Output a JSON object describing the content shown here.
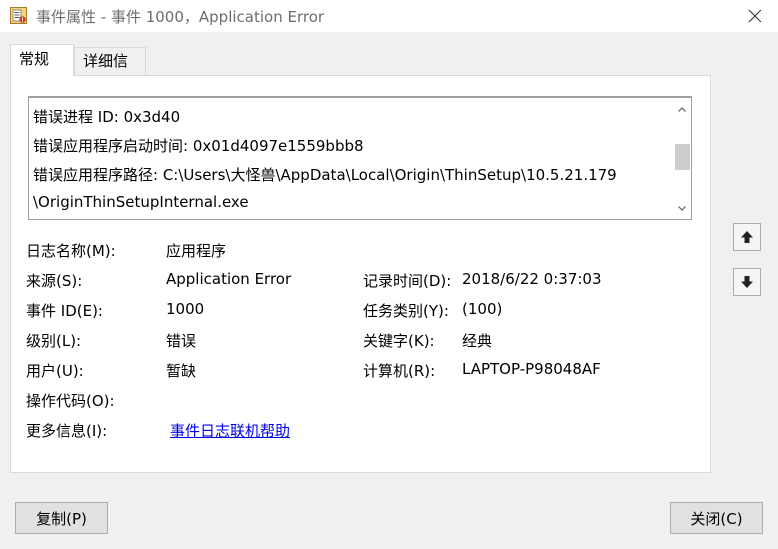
{
  "window": {
    "title": "事件属性 - 事件 1000，Application Error"
  },
  "tabs": [
    {
      "label": "常规"
    },
    {
      "label": "详细信息"
    }
  ],
  "description_lines": [
    "错误进程 ID: 0x3d40",
    "错误应用程序启动时间: 0x01d4097e1559bbb8",
    "错误应用程序路径: C:\\Users\\大怪兽\\AppData\\Local\\Origin\\ThinSetup\\10.5.21.179",
    "\\OriginThinSetupInternal.exe"
  ],
  "fields": {
    "log_name": {
      "label": "日志名称(M):",
      "value": "应用程序"
    },
    "source": {
      "label": "来源(S):",
      "value": "Application Error"
    },
    "logged": {
      "label": "记录时间(D):",
      "value": "2018/6/22 0:37:03"
    },
    "event_id": {
      "label": "事件 ID(E):",
      "value": "1000"
    },
    "task_category": {
      "label": "任务类别(Y):",
      "value": "(100)"
    },
    "level": {
      "label": "级别(L):",
      "value": "错误"
    },
    "keywords": {
      "label": "关键字(K):",
      "value": "经典"
    },
    "user": {
      "label": "用户(U):",
      "value": "暂缺"
    },
    "computer": {
      "label": "计算机(R):",
      "value": "LAPTOP-P98048AF"
    },
    "opcode": {
      "label": "操作代码(O):",
      "value": ""
    },
    "more_info": {
      "label": "更多信息(I):",
      "link": "事件日志联机帮助"
    }
  },
  "buttons": {
    "copy": "复制(P)",
    "close": "关闭(C)"
  },
  "icons": {
    "window": "event-viewer-icon",
    "up": "arrow-up-icon",
    "down": "arrow-down-icon",
    "close": "close-icon"
  }
}
